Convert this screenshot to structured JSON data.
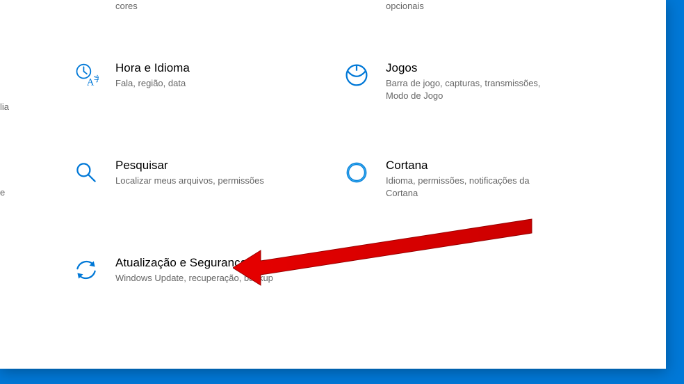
{
  "partial": {
    "cores": "cores",
    "opcionais": "opcionais",
    "lia": "lia",
    "e": "e"
  },
  "categories": {
    "time": {
      "title": "Hora e Idioma",
      "desc": "Fala, região, data"
    },
    "gaming": {
      "title": "Jogos",
      "desc": "Barra de jogo, capturas, transmissões, Modo de Jogo"
    },
    "search": {
      "title": "Pesquisar",
      "desc": "Localizar meus arquivos, permissões"
    },
    "cortana": {
      "title": "Cortana",
      "desc": "Idioma, permissões, notificações da Cortana"
    },
    "update": {
      "title": "Atualização e Segurança",
      "desc": "Windows Update, recuperação, backup"
    }
  },
  "colors": {
    "accent": "#0078d7",
    "text_secondary": "#666666"
  }
}
